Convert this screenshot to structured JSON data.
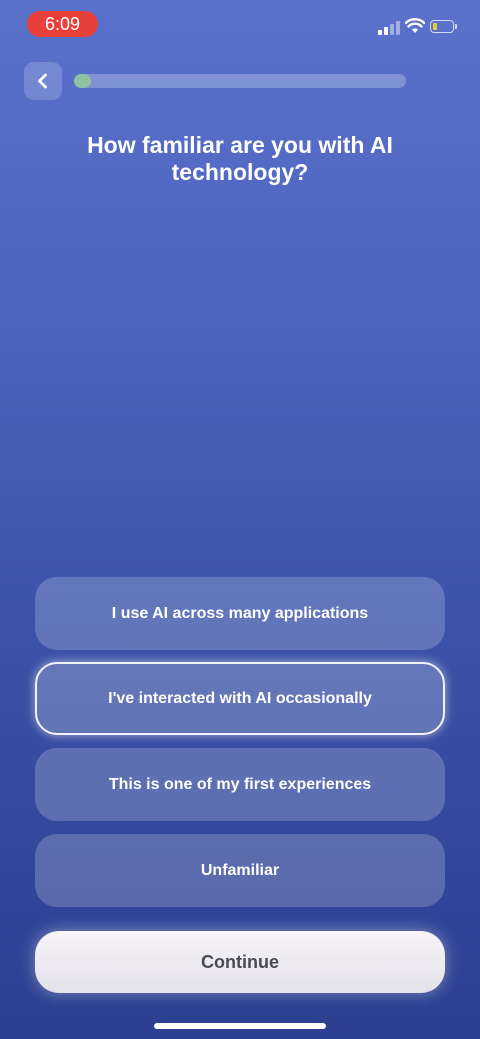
{
  "status_bar": {
    "time": "6:09",
    "battery_level": 0.2,
    "icons": [
      "cellular-signal-icon",
      "wifi-icon",
      "battery-icon"
    ]
  },
  "header": {
    "back_icon": "chevron-left-icon",
    "progress": 0.05
  },
  "question": "How familiar are you with AI technology?",
  "options": [
    {
      "label": "I use AI across many applications",
      "selected": false
    },
    {
      "label": "I've interacted with AI occasionally",
      "selected": true
    },
    {
      "label": "This is one of my first experiences",
      "selected": false
    },
    {
      "label": "Unfamiliar",
      "selected": false
    }
  ],
  "continue_label": "Continue",
  "colors": {
    "background_top": "#5a72cc",
    "background_bottom": "#2c3e8f",
    "progress_fill": "#8fc1a3",
    "time_pill": "#e8413b",
    "battery_fill": "#f2cc2c"
  }
}
